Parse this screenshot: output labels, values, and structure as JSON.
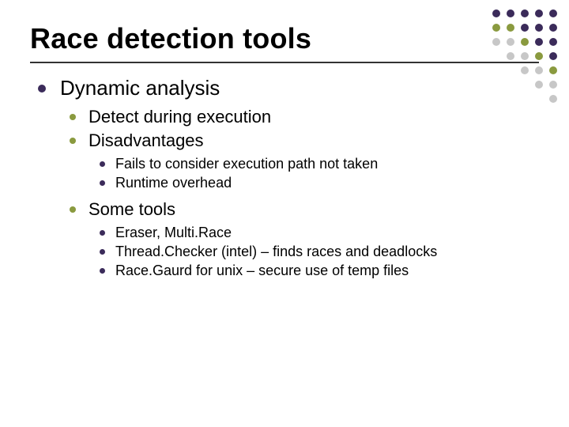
{
  "title": "Race detection tools",
  "bullets": {
    "lvl1_0": "Dynamic analysis",
    "lvl2_0": "Detect during execution",
    "lvl2_1": "Disadvantages",
    "lvl3_0": "Fails to consider execution path not taken",
    "lvl3_1": "Runtime overhead",
    "lvl2_2": "Some tools",
    "lvl3_2": "Eraser, Multi.Race",
    "lvl3_3": "Thread.Checker (intel) – finds races and deadlocks",
    "lvl3_4": "Race.Gaurd for unix – secure use of temp files"
  },
  "decor": {
    "dot_colors": [
      "#3b2b5a",
      "#3b2b5a",
      "#3b2b5a",
      "#3b2b5a",
      "#3b2b5a",
      "#8a9a3f",
      "#8a9a3f",
      "#3b2b5a",
      "#3b2b5a",
      "#3b2b5a",
      "#c7c7c7",
      "#c7c7c7",
      "#8a9a3f",
      "#3b2b5a",
      "#3b2b5a",
      "#ffffff",
      "#c7c7c7",
      "#c7c7c7",
      "#8a9a3f",
      "#3b2b5a",
      "#ffffff",
      "#ffffff",
      "#c7c7c7",
      "#c7c7c7",
      "#8a9a3f",
      "#ffffff",
      "#ffffff",
      "#ffffff",
      "#c7c7c7",
      "#c7c7c7",
      "#ffffff",
      "#ffffff",
      "#ffffff",
      "#ffffff",
      "#c7c7c7"
    ]
  }
}
